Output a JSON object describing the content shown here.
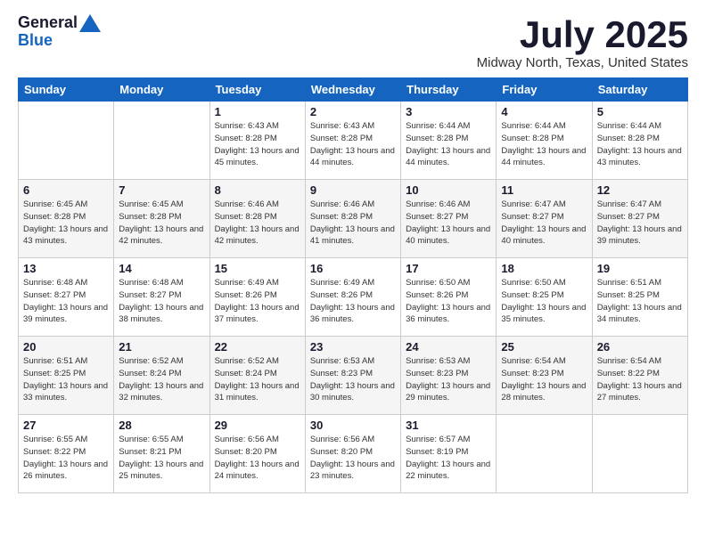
{
  "logo": {
    "general": "General",
    "blue": "Blue"
  },
  "title": "July 2025",
  "location": "Midway North, Texas, United States",
  "days_of_week": [
    "Sunday",
    "Monday",
    "Tuesday",
    "Wednesday",
    "Thursday",
    "Friday",
    "Saturday"
  ],
  "weeks": [
    [
      {
        "day": "",
        "info": ""
      },
      {
        "day": "",
        "info": ""
      },
      {
        "day": "1",
        "info": "Sunrise: 6:43 AM\nSunset: 8:28 PM\nDaylight: 13 hours and 45 minutes."
      },
      {
        "day": "2",
        "info": "Sunrise: 6:43 AM\nSunset: 8:28 PM\nDaylight: 13 hours and 44 minutes."
      },
      {
        "day": "3",
        "info": "Sunrise: 6:44 AM\nSunset: 8:28 PM\nDaylight: 13 hours and 44 minutes."
      },
      {
        "day": "4",
        "info": "Sunrise: 6:44 AM\nSunset: 8:28 PM\nDaylight: 13 hours and 44 minutes."
      },
      {
        "day": "5",
        "info": "Sunrise: 6:44 AM\nSunset: 8:28 PM\nDaylight: 13 hours and 43 minutes."
      }
    ],
    [
      {
        "day": "6",
        "info": "Sunrise: 6:45 AM\nSunset: 8:28 PM\nDaylight: 13 hours and 43 minutes."
      },
      {
        "day": "7",
        "info": "Sunrise: 6:45 AM\nSunset: 8:28 PM\nDaylight: 13 hours and 42 minutes."
      },
      {
        "day": "8",
        "info": "Sunrise: 6:46 AM\nSunset: 8:28 PM\nDaylight: 13 hours and 42 minutes."
      },
      {
        "day": "9",
        "info": "Sunrise: 6:46 AM\nSunset: 8:28 PM\nDaylight: 13 hours and 41 minutes."
      },
      {
        "day": "10",
        "info": "Sunrise: 6:46 AM\nSunset: 8:27 PM\nDaylight: 13 hours and 40 minutes."
      },
      {
        "day": "11",
        "info": "Sunrise: 6:47 AM\nSunset: 8:27 PM\nDaylight: 13 hours and 40 minutes."
      },
      {
        "day": "12",
        "info": "Sunrise: 6:47 AM\nSunset: 8:27 PM\nDaylight: 13 hours and 39 minutes."
      }
    ],
    [
      {
        "day": "13",
        "info": "Sunrise: 6:48 AM\nSunset: 8:27 PM\nDaylight: 13 hours and 39 minutes."
      },
      {
        "day": "14",
        "info": "Sunrise: 6:48 AM\nSunset: 8:27 PM\nDaylight: 13 hours and 38 minutes."
      },
      {
        "day": "15",
        "info": "Sunrise: 6:49 AM\nSunset: 8:26 PM\nDaylight: 13 hours and 37 minutes."
      },
      {
        "day": "16",
        "info": "Sunrise: 6:49 AM\nSunset: 8:26 PM\nDaylight: 13 hours and 36 minutes."
      },
      {
        "day": "17",
        "info": "Sunrise: 6:50 AM\nSunset: 8:26 PM\nDaylight: 13 hours and 36 minutes."
      },
      {
        "day": "18",
        "info": "Sunrise: 6:50 AM\nSunset: 8:25 PM\nDaylight: 13 hours and 35 minutes."
      },
      {
        "day": "19",
        "info": "Sunrise: 6:51 AM\nSunset: 8:25 PM\nDaylight: 13 hours and 34 minutes."
      }
    ],
    [
      {
        "day": "20",
        "info": "Sunrise: 6:51 AM\nSunset: 8:25 PM\nDaylight: 13 hours and 33 minutes."
      },
      {
        "day": "21",
        "info": "Sunrise: 6:52 AM\nSunset: 8:24 PM\nDaylight: 13 hours and 32 minutes."
      },
      {
        "day": "22",
        "info": "Sunrise: 6:52 AM\nSunset: 8:24 PM\nDaylight: 13 hours and 31 minutes."
      },
      {
        "day": "23",
        "info": "Sunrise: 6:53 AM\nSunset: 8:23 PM\nDaylight: 13 hours and 30 minutes."
      },
      {
        "day": "24",
        "info": "Sunrise: 6:53 AM\nSunset: 8:23 PM\nDaylight: 13 hours and 29 minutes."
      },
      {
        "day": "25",
        "info": "Sunrise: 6:54 AM\nSunset: 8:23 PM\nDaylight: 13 hours and 28 minutes."
      },
      {
        "day": "26",
        "info": "Sunrise: 6:54 AM\nSunset: 8:22 PM\nDaylight: 13 hours and 27 minutes."
      }
    ],
    [
      {
        "day": "27",
        "info": "Sunrise: 6:55 AM\nSunset: 8:22 PM\nDaylight: 13 hours and 26 minutes."
      },
      {
        "day": "28",
        "info": "Sunrise: 6:55 AM\nSunset: 8:21 PM\nDaylight: 13 hours and 25 minutes."
      },
      {
        "day": "29",
        "info": "Sunrise: 6:56 AM\nSunset: 8:20 PM\nDaylight: 13 hours and 24 minutes."
      },
      {
        "day": "30",
        "info": "Sunrise: 6:56 AM\nSunset: 8:20 PM\nDaylight: 13 hours and 23 minutes."
      },
      {
        "day": "31",
        "info": "Sunrise: 6:57 AM\nSunset: 8:19 PM\nDaylight: 13 hours and 22 minutes."
      },
      {
        "day": "",
        "info": ""
      },
      {
        "day": "",
        "info": ""
      }
    ]
  ]
}
